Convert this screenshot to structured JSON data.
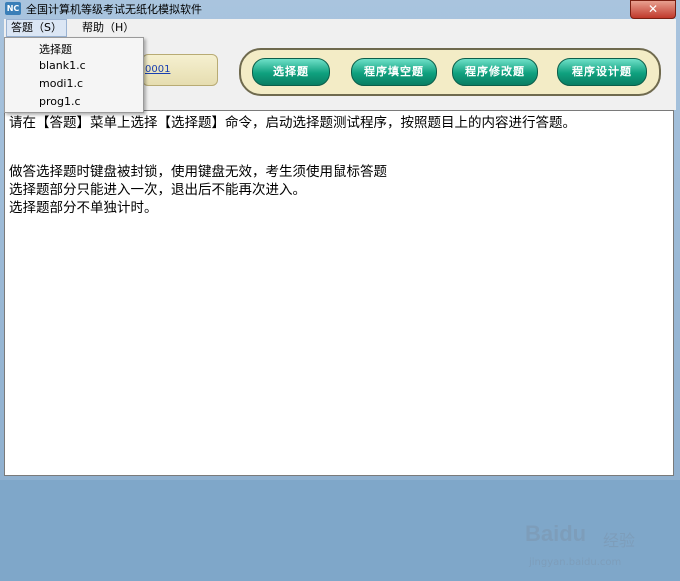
{
  "window": {
    "title": "全国计算机等级考试无纸化模拟软件",
    "app_icon_text": "NC",
    "close_label": "✕"
  },
  "menubar": {
    "answer": "答题（S）",
    "help": "帮助（H）"
  },
  "answer_menu": {
    "items": [
      "选择题",
      "blank1.c",
      "modi1.c",
      "prog1.c"
    ]
  },
  "toolbar": {
    "exam_id": "0001",
    "buttons": [
      "选择题",
      "程序填空题",
      "程序修改题",
      "程序设计题"
    ]
  },
  "content": {
    "paragraph": "请在【答题】菜单上选择【选择题】命令，启动选择题测试程序，按照题目上的内容进行答题。",
    "lines": [
      "做答选择题时键盘被封锁，使用键盘无效，考生须使用鼠标答题",
      "选择题部分只能进入一次，退出后不能再次进入。",
      "选择题部分不单独计时。"
    ]
  },
  "watermark": {
    "logo": "Baidu",
    "label": "经验",
    "url": "jingyan.baidu.com"
  },
  "colors": {
    "button_green": "#0fa07e",
    "panel_bg": "#f3ecc6",
    "link_blue": "#1a3fb0"
  }
}
